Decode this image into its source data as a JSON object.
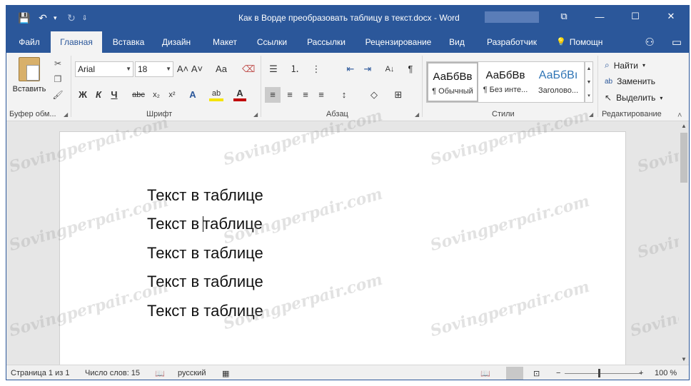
{
  "window": {
    "title": "Как в Ворде преобразовать таблицу в текст.docx - Word",
    "controls": {
      "ribbon_options": "⧉",
      "minimize": "—",
      "maximize": "☐",
      "close": "✕"
    }
  },
  "qat": {
    "save_icon": "💾",
    "undo_icon": "↶",
    "undo_arrow": "▾",
    "redo_icon": "↻",
    "customize": "⇩"
  },
  "tabs": [
    {
      "label": "Файл"
    },
    {
      "label": "Главная"
    },
    {
      "label": "Вставка"
    },
    {
      "label": "Дизайн"
    },
    {
      "label": "Макет"
    },
    {
      "label": "Ссылки"
    },
    {
      "label": "Рассылки"
    },
    {
      "label": "Рецензирование"
    },
    {
      "label": "Вид"
    },
    {
      "label": "Разработчик"
    }
  ],
  "tell_me": {
    "label": "Помощн",
    "icon": "💡"
  },
  "tab_icons": {
    "share": "⚇",
    "comments": "▭"
  },
  "ribbon": {
    "clipboard": {
      "paste_label": "Вставить",
      "group_label": "Буфер обм...",
      "launcher": "◢"
    },
    "font": {
      "name": "Arial",
      "size": "18",
      "grow": "A˄",
      "shrink": "A˅",
      "case": "Aa",
      "clear": "⌫",
      "bold": "Ж",
      "italic": "К",
      "underline": "Ч",
      "strike": "abc",
      "subscript": "x₂",
      "superscript": "x²",
      "effects": "A",
      "highlight": "ab",
      "color": "A",
      "group_label": "Шрифт",
      "launcher": "◢",
      "highlight_color": "#f5e400",
      "font_color": "#c00000"
    },
    "paragraph": {
      "bullets": "☰",
      "numbering": "⒈",
      "multilevel": "⋮",
      "decrease_indent": "⇤",
      "increase_indent": "⇥",
      "sort": "A↓",
      "pilcrow": "¶",
      "align_left": "≡",
      "align_center": "≡",
      "align_right": "≡",
      "justify": "≡",
      "spacing": "↕",
      "shading": "◇",
      "borders": "⊞",
      "group_label": "Абзац",
      "launcher": "◢"
    },
    "styles": {
      "items": [
        {
          "preview": "АаБбВв",
          "name": "¶ Обычный"
        },
        {
          "preview": "АаБбВв",
          "name": "¶ Без инте..."
        },
        {
          "preview": "АаБбВı",
          "name": "Заголово..."
        }
      ],
      "group_label": "Стили",
      "launcher": "◢",
      "scroll": [
        "▲",
        "▼",
        "▾"
      ]
    },
    "editing": {
      "find": "Найти",
      "replace": "Заменить",
      "select": "Выделить",
      "group_label": "Редактирование",
      "collapse": "˄"
    }
  },
  "document": {
    "lines": [
      "Текст в таблице",
      [
        "Текст в ",
        "таблице"
      ],
      "Текст в таблице",
      "Текст в таблице",
      "Текст в таблице"
    ]
  },
  "watermark": "Sovingperpair.com",
  "statusbar": {
    "page": "Страница 1 из 1",
    "words": "Число слов: 15",
    "language": "русский",
    "zoom": "100 %",
    "zoom_minus": "−",
    "zoom_plus": "+",
    "zoom_level": 1.0
  }
}
